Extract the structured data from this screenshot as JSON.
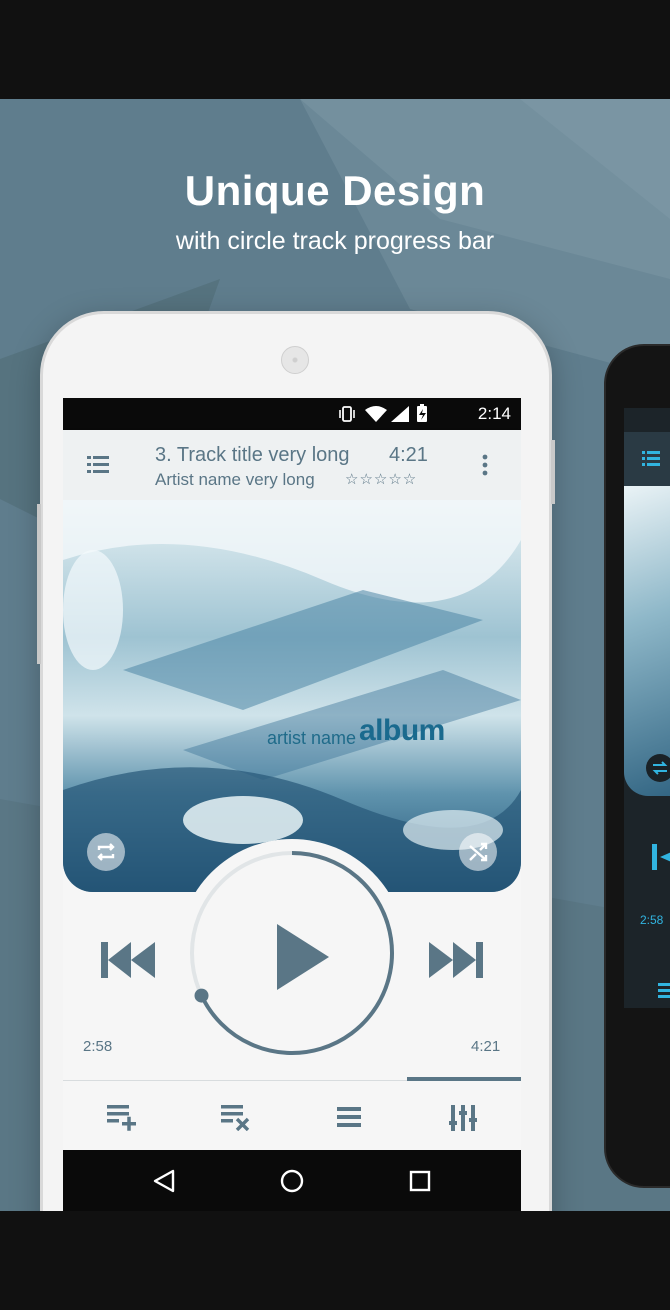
{
  "promo": {
    "headline": "Unique Design",
    "subline": "with circle track progress bar"
  },
  "status_bar": {
    "time": "2:14",
    "icons": [
      "vibrate-icon",
      "wifi-icon",
      "signal-icon",
      "battery-icon"
    ]
  },
  "header": {
    "track_title": "3. Track title very long",
    "duration": "4:21",
    "artist": "Artist name very long",
    "rating": "☆☆☆☆☆",
    "rating_value": 0,
    "rating_max": 5
  },
  "album_art": {
    "artist_text": "artist name",
    "album_text": "album"
  },
  "player": {
    "elapsed": "2:58",
    "total": "4:21",
    "progress": 0.68
  },
  "tabs": {
    "items": [
      "add-to-playlist-icon",
      "remove-from-playlist-icon",
      "queue-list-icon",
      "equalizer-icon"
    ],
    "selected_index": 3
  },
  "second_phone": {
    "elapsed": "2:58"
  },
  "colors": {
    "accent": "#5a7686",
    "promo_bg": "#5f7d8d",
    "second_phone_accent": "#31b4e0"
  }
}
